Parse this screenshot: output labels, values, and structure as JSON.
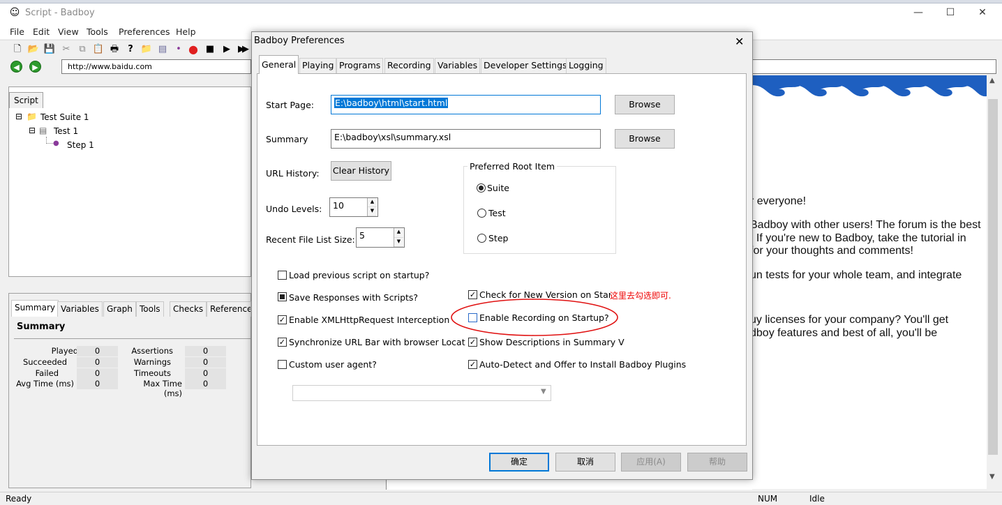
{
  "window": {
    "title": "Script - Badboy",
    "minimize": "—",
    "maximize": "☐",
    "close": "✕"
  },
  "menu": [
    "File",
    "Edit",
    "View",
    "Tools",
    "Preferences",
    "Help"
  ],
  "address": {
    "url": "http://www.baidu.com"
  },
  "script_panel": {
    "tab": "Script",
    "tree": [
      "Test Suite 1",
      "Test 1",
      "Step 1"
    ]
  },
  "lower_panel": {
    "tabs": [
      "Summary",
      "Variables",
      "Graph",
      "Tools",
      "Checks",
      "Reference"
    ],
    "heading": "Summary",
    "stats_left": [
      {
        "label": "Played",
        "value": "0"
      },
      {
        "label": "Succeeded",
        "value": "0"
      },
      {
        "label": "Failed",
        "value": "0"
      },
      {
        "label": "Avg Time (ms)",
        "value": "0"
      }
    ],
    "stats_right": [
      {
        "label": "Assertions",
        "value": "0"
      },
      {
        "label": "Warnings",
        "value": "0"
      },
      {
        "label": "Timeouts",
        "value": "0"
      },
      {
        "label": "Max Time (ms)",
        "value": "0"
      }
    ]
  },
  "browser_page": {
    "lines": [
      "r everyone!",
      "Badboy with other users! The forum is the best",
      ". If you're new to Badboy, take the tutorial in",
      "for your thoughts and comments!",
      "un tests for your whole team, and integrate",
      "uy licenses for your company? You'll get",
      "dboy features and best of all, you'll be"
    ]
  },
  "status": {
    "left": "Ready",
    "num": "NUM",
    "state": "Idle"
  },
  "dialog": {
    "title": "Badboy Preferences",
    "close": "✕",
    "tabs": [
      "General",
      "Playing",
      "Programs",
      "Recording",
      "Variables",
      "Developer Settings",
      "Logging"
    ],
    "start_page": {
      "label": "Start Page:",
      "value": "E:\\badboy\\html\\start.html",
      "button": "Browse"
    },
    "summary": {
      "label": "Summary",
      "value": "E:\\badboy\\xsl\\summary.xsl",
      "button": "Browse"
    },
    "url_history": {
      "label": "URL History:",
      "button": "Clear History"
    },
    "undo_levels": {
      "label": "Undo Levels:",
      "value": "10"
    },
    "recent_files": {
      "label": "Recent File List Size:",
      "value": "5"
    },
    "root_item": {
      "title": "Preferred Root Item",
      "options": [
        "Suite",
        "Test",
        "Step"
      ],
      "selected": "Suite"
    },
    "checkboxes_left": [
      {
        "label": "Load previous script on startup?",
        "state": "unchecked"
      },
      {
        "label": "Save Responses with Scripts?",
        "state": "indeterminate"
      },
      {
        "label": "Enable XMLHttpRequest Interception",
        "state": "checked"
      },
      {
        "label": "Synchronize URL Bar with browser Location",
        "state": "checked"
      },
      {
        "label": "Custom user agent?",
        "state": "unchecked"
      }
    ],
    "checkboxes_right": [
      {
        "label": "Check for New Version on Startup",
        "state": "checked"
      },
      {
        "label": "Enable Recording on Startup?",
        "state": "unchecked"
      },
      {
        "label": "Show Descriptions in Summary View",
        "state": "checked"
      },
      {
        "label": "Auto-Detect and Offer to Install Badboy Plugins",
        "state": "checked"
      }
    ],
    "annotation": "这里去勾选即可.",
    "buttons": {
      "ok": "确定",
      "cancel": "取消",
      "apply": "应用(A)",
      "help": "帮助"
    }
  }
}
